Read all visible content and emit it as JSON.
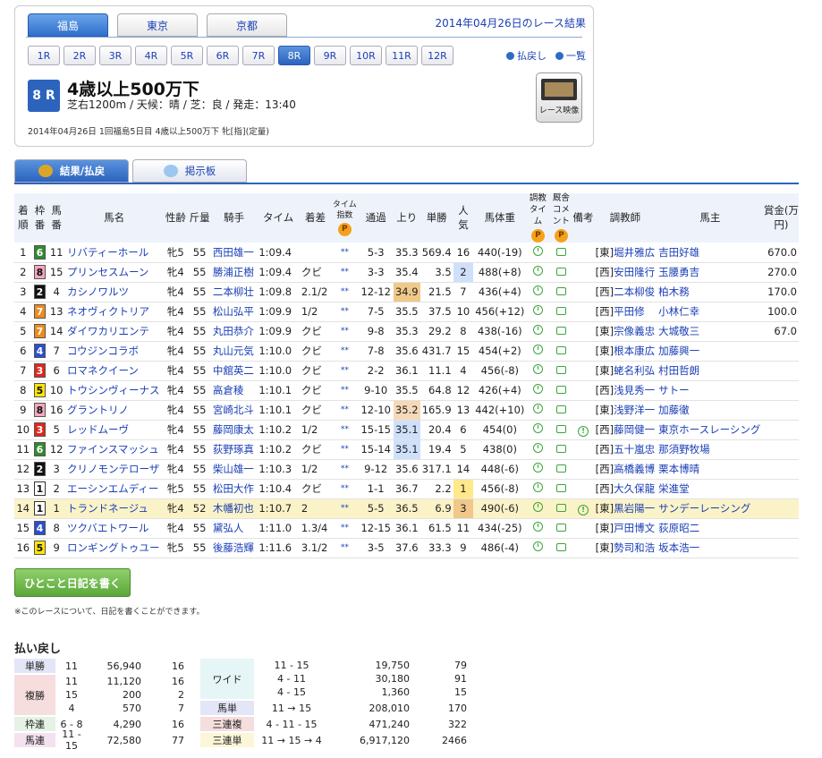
{
  "header": {
    "courses": [
      "福島",
      "東京",
      "京都"
    ],
    "active_course": 0,
    "page_title": "2014年04月26日のレース結果"
  },
  "races": {
    "labels": [
      "1R",
      "2R",
      "3R",
      "4R",
      "5R",
      "6R",
      "7R",
      "8R",
      "9R",
      "10R",
      "11R",
      "12R"
    ],
    "active": 7,
    "payback_link": "払戻し",
    "list_link": "一覧"
  },
  "race": {
    "num": "8 R",
    "name": "4歳以上500万下",
    "conditions": "芝右1200m / 天候：晴 / 芝：良 / 発走：13:40",
    "info": "2014年04月26日 1回福島5日目 4歳以上500万下 牝[指](定量)",
    "video_label": "レース映像"
  },
  "tabs": {
    "results": "結果/払戻",
    "board": "掲示板"
  },
  "table": {
    "headers": [
      "着順",
      "枠番",
      "馬番",
      "馬名",
      "性齢",
      "斤量",
      "騎手",
      "タイム",
      "着差",
      "タイム指数",
      "通過",
      "上り",
      "単勝",
      "人気",
      "馬体重",
      "調教タイム",
      "厩舎コメント",
      "備考",
      "調教師",
      "馬主",
      "賞金(万円)"
    ],
    "rows": [
      [
        "1",
        "6",
        "11",
        "リバティーホール",
        "牝5",
        "55",
        "西田雄一",
        "1:09.4",
        "",
        "**",
        "5-3",
        "35.3",
        "569.4",
        "16",
        "440(-19)",
        "[東]",
        "堀井雅広",
        "吉田好雄",
        "670.0"
      ],
      [
        "2",
        "8",
        "15",
        "プリンセスムーン",
        "牝4",
        "55",
        "勝浦正樹",
        "1:09.4",
        "クビ",
        "**",
        "3-3",
        "35.4",
        "3.5",
        "2",
        "488(+8)",
        "[西]",
        "安田隆行",
        "玉腰勇吉",
        "270.0"
      ],
      [
        "3",
        "2",
        "4",
        "カシノワルツ",
        "牝4",
        "55",
        "二本柳壮",
        "1:09.8",
        "2.1/2",
        "**",
        "12-12",
        "34.9",
        "21.5",
        "7",
        "436(+4)",
        "[西]",
        "二本柳俊",
        "柏木務",
        "170.0"
      ],
      [
        "4",
        "7",
        "13",
        "ネオヴィクトリア",
        "牝4",
        "55",
        "松山弘平",
        "1:09.9",
        "1/2",
        "**",
        "7-5",
        "35.5",
        "37.5",
        "10",
        "456(+12)",
        "[西]",
        "平田修",
        "小林仁幸",
        "100.0"
      ],
      [
        "5",
        "7",
        "14",
        "ダイワカリエンテ",
        "牝4",
        "55",
        "丸田恭介",
        "1:09.9",
        "クビ",
        "**",
        "9-8",
        "35.3",
        "29.2",
        "8",
        "438(-16)",
        "[東]",
        "宗像義忠",
        "大城敬三",
        "67.0"
      ],
      [
        "6",
        "4",
        "7",
        "コウジンコラボ",
        "牝4",
        "55",
        "丸山元気",
        "1:10.0",
        "クビ",
        "**",
        "7-8",
        "35.6",
        "431.7",
        "15",
        "454(+2)",
        "[東]",
        "根本康広",
        "加藤興一",
        ""
      ],
      [
        "7",
        "3",
        "6",
        "ロマネクイーン",
        "牝4",
        "55",
        "中舘英二",
        "1:10.0",
        "クビ",
        "**",
        "2-2",
        "36.1",
        "11.1",
        "4",
        "456(-8)",
        "[東]",
        "蛯名利弘",
        "村田哲朗",
        ""
      ],
      [
        "8",
        "5",
        "10",
        "トウシンヴィーナス",
        "牝4",
        "55",
        "高倉稜",
        "1:10.1",
        "クビ",
        "**",
        "9-10",
        "35.5",
        "64.8",
        "12",
        "426(+4)",
        "[西]",
        "浅見秀一",
        "サトー",
        ""
      ],
      [
        "9",
        "8",
        "16",
        "グラントリノ",
        "牝4",
        "55",
        "宮崎北斗",
        "1:10.1",
        "クビ",
        "**",
        "12-10",
        "35.2",
        "165.9",
        "13",
        "442(+10)",
        "[東]",
        "浅野洋一",
        "加藤徹",
        ""
      ],
      [
        "10",
        "3",
        "5",
        "レッドムーヴ",
        "牝4",
        "55",
        "藤岡康太",
        "1:10.2",
        "1/2",
        "**",
        "15-15",
        "35.1",
        "20.4",
        "6",
        "454(0)",
        "[西]",
        "藤岡健一",
        "東京ホースレーシング",
        ""
      ],
      [
        "11",
        "6",
        "12",
        "ファインスマッシュ",
        "牝4",
        "55",
        "荻野琢真",
        "1:10.2",
        "クビ",
        "**",
        "15-14",
        "35.1",
        "19.4",
        "5",
        "438(0)",
        "[西]",
        "五十嵐忠",
        "那須野牧場",
        ""
      ],
      [
        "12",
        "2",
        "3",
        "クリノモンテローザ",
        "牝4",
        "55",
        "柴山雄一",
        "1:10.3",
        "1/2",
        "**",
        "9-12",
        "35.6",
        "317.1",
        "14",
        "448(-6)",
        "[西]",
        "高橋義博",
        "栗本博晴",
        ""
      ],
      [
        "13",
        "1",
        "2",
        "エーシンエムディー",
        "牝5",
        "55",
        "松田大作",
        "1:10.4",
        "クビ",
        "**",
        "1-1",
        "36.7",
        "2.2",
        "1",
        "456(-8)",
        "[西]",
        "大久保龍",
        "栄進堂",
        ""
      ],
      [
        "14",
        "1",
        "1",
        "トランドネージュ",
        "牝4",
        "52",
        "木幡初也",
        "1:10.7",
        "2",
        "**",
        "5-5",
        "36.5",
        "6.9",
        "3",
        "490(-6)",
        "[東]",
        "黒岩陽一",
        "サンデーレーシング",
        ""
      ],
      [
        "15",
        "4",
        "8",
        "ツクバエトワール",
        "牝4",
        "55",
        "黛弘人",
        "1:11.0",
        "1.3/4",
        "**",
        "12-15",
        "36.1",
        "61.5",
        "11",
        "434(-25)",
        "[東]",
        "戸田博文",
        "荻原昭二",
        ""
      ],
      [
        "16",
        "5",
        "9",
        "ロンギングトゥユー",
        "牝5",
        "55",
        "後藤浩輝",
        "1:11.6",
        "3.1/2",
        "**",
        "3-5",
        "37.6",
        "33.3",
        "9",
        "486(-4)",
        "[東]",
        "勢司和浩",
        "坂本浩一",
        ""
      ]
    ]
  },
  "diary": {
    "button": "ひとこと日記を書く",
    "note": "※このレースについて、日記を書くことができます。"
  },
  "payout": {
    "title": "払い戻し",
    "left": [
      {
        "label": "単勝",
        "lines": [
          [
            "11",
            "56,940",
            "16"
          ]
        ]
      },
      {
        "label": "複勝",
        "lines": [
          [
            "11",
            "11,120",
            "16"
          ],
          [
            "15",
            "200",
            "2"
          ],
          [
            "4",
            "570",
            "7"
          ]
        ]
      },
      {
        "label": "枠連",
        "lines": [
          [
            "6 - 8",
            "4,290",
            "16"
          ]
        ]
      },
      {
        "label": "馬連",
        "lines": [
          [
            "11 - 15",
            "72,580",
            "77"
          ]
        ]
      }
    ],
    "right": [
      {
        "label": "ワイド",
        "lines": [
          [
            "11 - 15",
            "19,750",
            "79"
          ],
          [
            "4 - 11",
            "30,180",
            "91"
          ],
          [
            "4 - 15",
            "1,360",
            "15"
          ]
        ]
      },
      {
        "label": "馬単",
        "lines": [
          [
            "11 → 15",
            "208,010",
            "170"
          ]
        ]
      },
      {
        "label": "三連複",
        "lines": [
          [
            "4 - 11 - 15",
            "471,240",
            "322"
          ]
        ]
      },
      {
        "label": "三連単",
        "lines": [
          [
            "11 → 15 → 4",
            "6,917,120",
            "2466"
          ]
        ]
      }
    ]
  },
  "colors": {
    "waku": {
      "1": "#ffffff",
      "2": "#111111",
      "3": "#e0261e",
      "4": "#2a4fd0",
      "5": "#ffe600",
      "6": "#2e8b2e",
      "7": "#f08a1a",
      "8": "#f3a7bd"
    },
    "accent": "#2c63bd"
  }
}
